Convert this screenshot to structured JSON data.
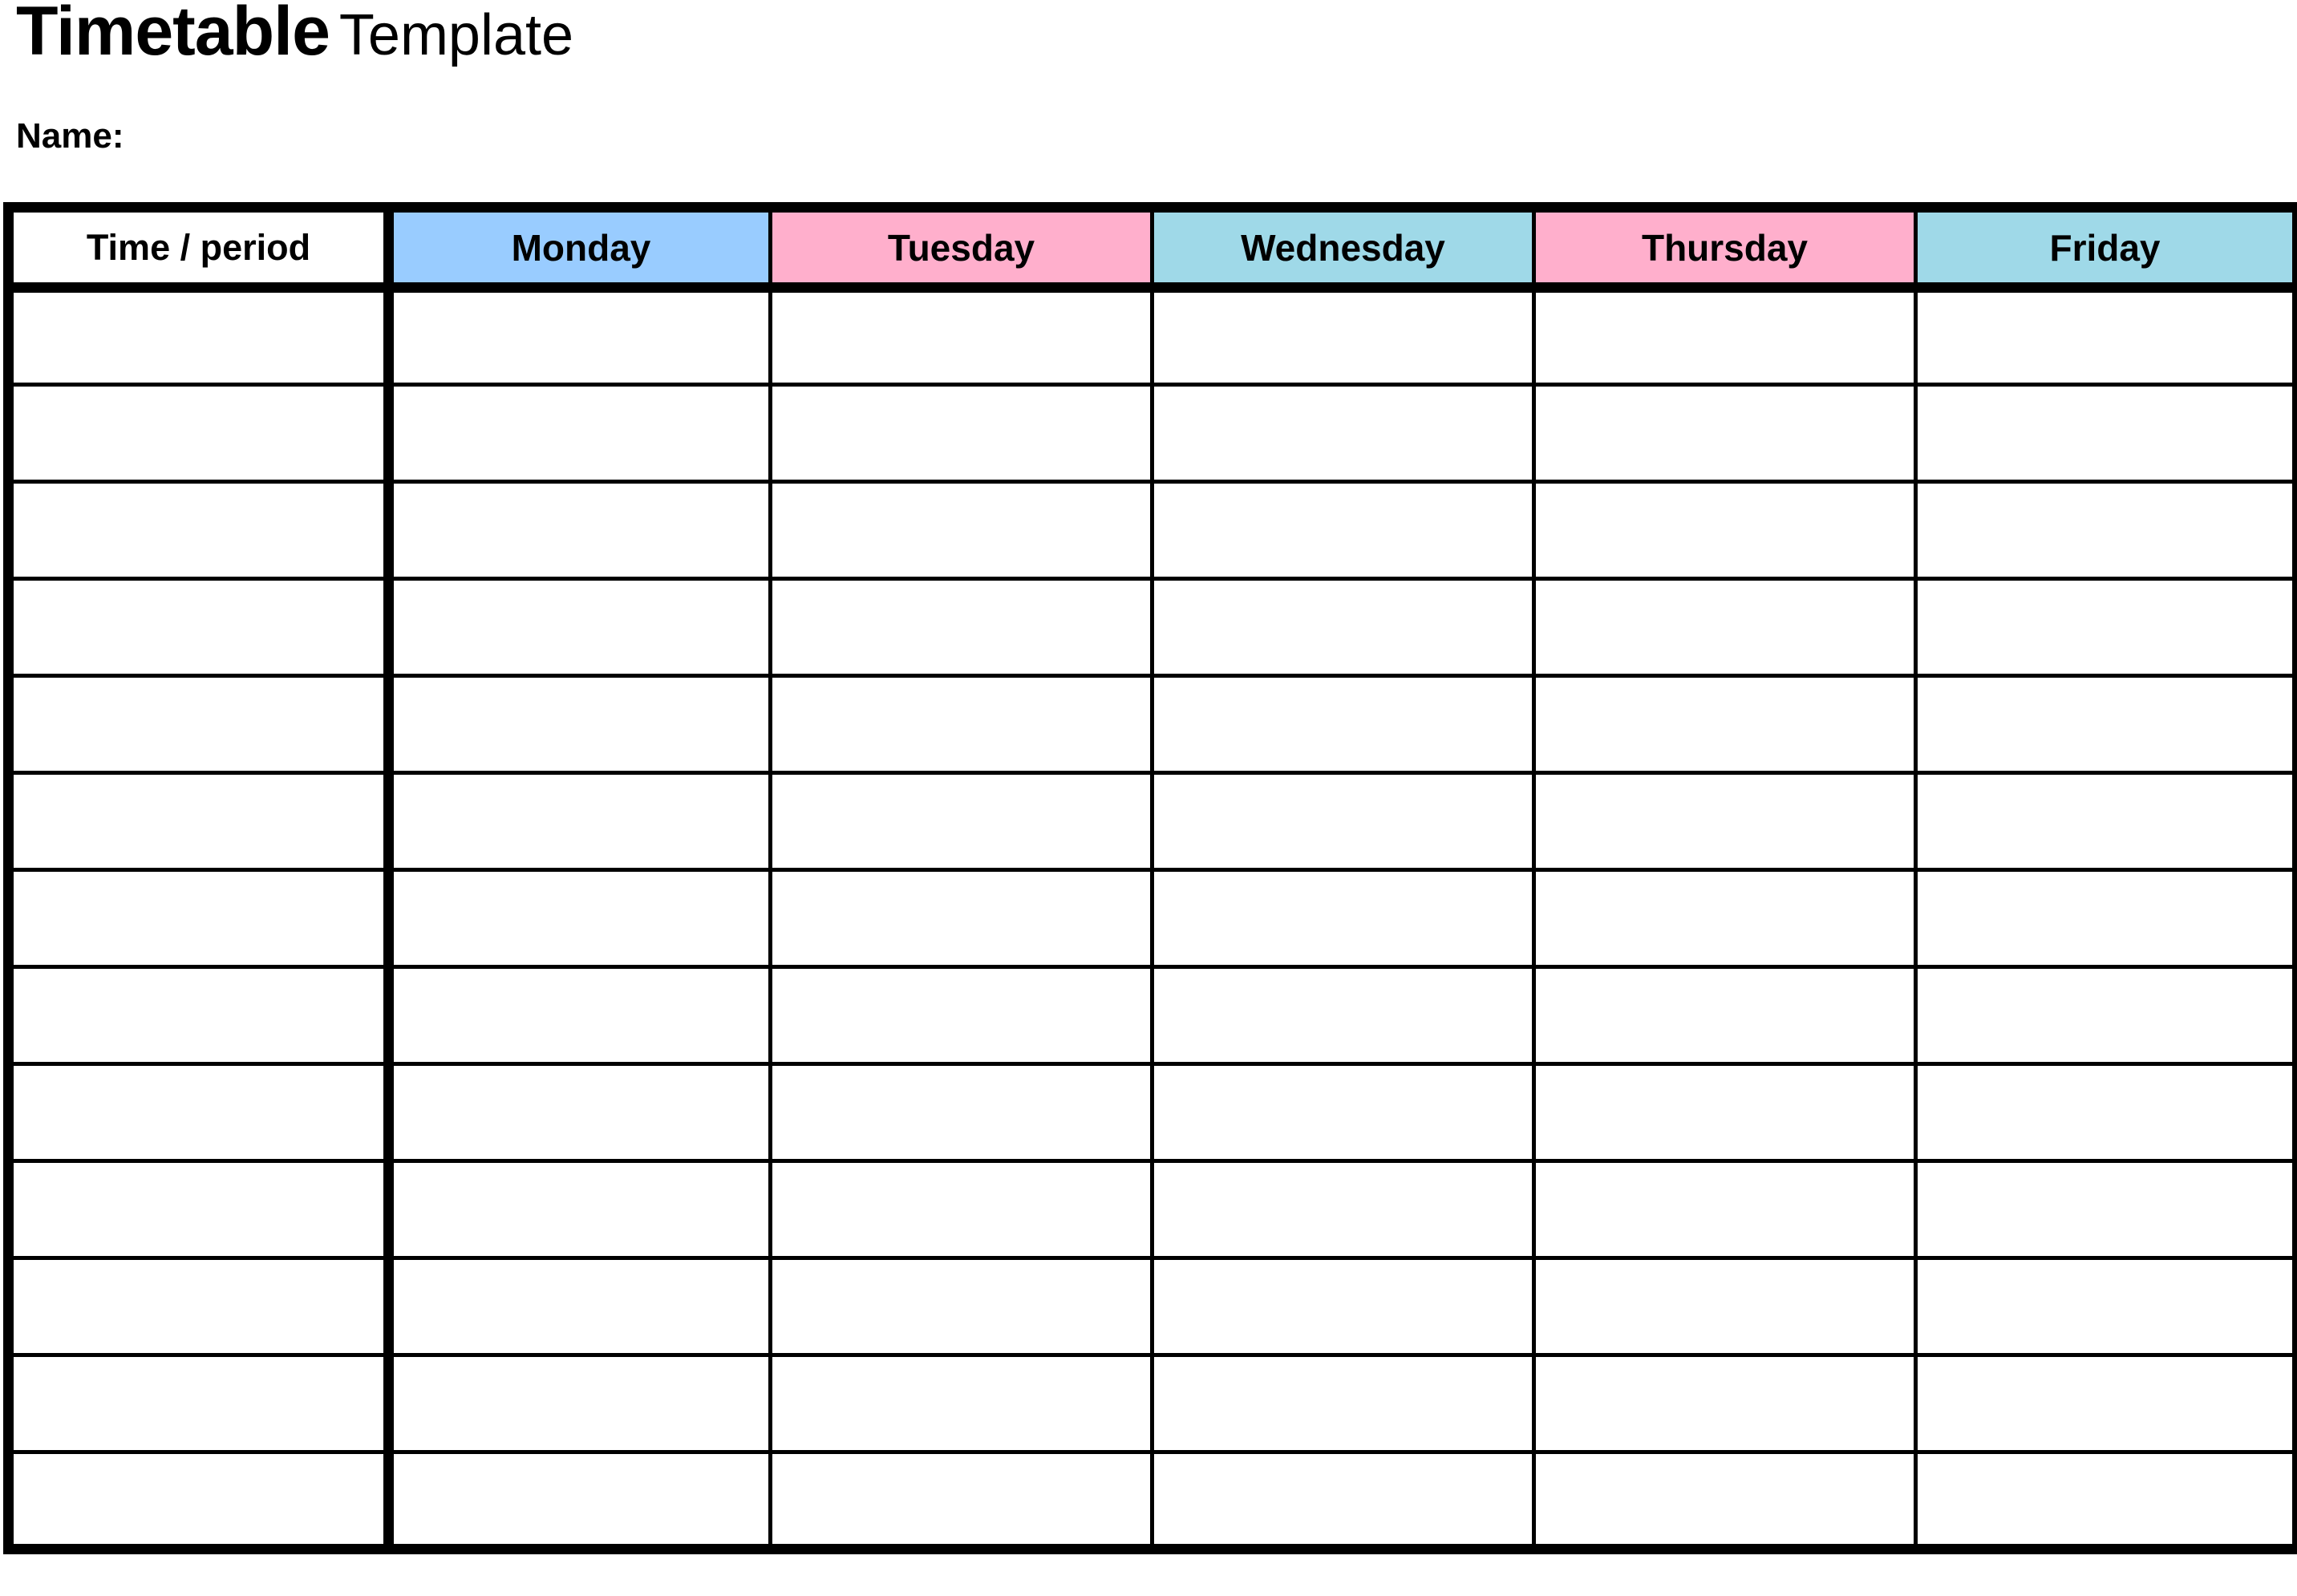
{
  "document": {
    "title_strong": "Timetable",
    "title_light": "Template",
    "name_label": "Name:"
  },
  "table": {
    "columns": [
      {
        "label": "Time / period",
        "bg": "#FFFFFF",
        "kind": "time"
      },
      {
        "label": "Monday",
        "bg": "#99CCFF",
        "kind": "day"
      },
      {
        "label": "Tuesday",
        "bg": "#FFAFCC",
        "kind": "day"
      },
      {
        "label": "Wednesday",
        "bg": "#9FD9E8",
        "kind": "day"
      },
      {
        "label": "Thursday",
        "bg": "#FFAFCC",
        "kind": "day"
      },
      {
        "label": "Friday",
        "bg": "#9FD9E8",
        "kind": "day"
      }
    ],
    "row_count": 13,
    "rows": [
      [
        "",
        "",
        "",
        "",
        "",
        ""
      ],
      [
        "",
        "",
        "",
        "",
        "",
        ""
      ],
      [
        "",
        "",
        "",
        "",
        "",
        ""
      ],
      [
        "",
        "",
        "",
        "",
        "",
        ""
      ],
      [
        "",
        "",
        "",
        "",
        "",
        ""
      ],
      [
        "",
        "",
        "",
        "",
        "",
        ""
      ],
      [
        "",
        "",
        "",
        "",
        "",
        ""
      ],
      [
        "",
        "",
        "",
        "",
        "",
        ""
      ],
      [
        "",
        "",
        "",
        "",
        "",
        ""
      ],
      [
        "",
        "",
        "",
        "",
        "",
        ""
      ],
      [
        "",
        "",
        "",
        "",
        "",
        ""
      ],
      [
        "",
        "",
        "",
        "",
        "",
        ""
      ],
      [
        "",
        "",
        "",
        "",
        "",
        ""
      ]
    ]
  },
  "colors": {
    "border": "#000000",
    "text": "#000000",
    "page_bg": "#FFFFFF",
    "monday": "#99CCFF",
    "tuesday": "#FFAFCC",
    "wednesday": "#9FD9E8",
    "thursday": "#FFAFCC",
    "friday": "#9FD9E8"
  }
}
